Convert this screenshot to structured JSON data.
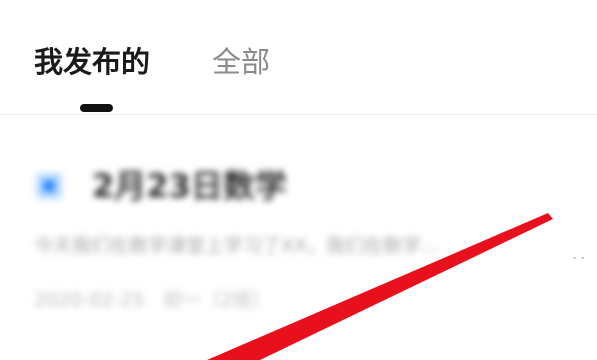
{
  "tabs": {
    "mine_label": "我发布的",
    "all_label": "全部"
  },
  "post": {
    "title": "2月23日数学",
    "description": "今天我们在数学课堂上学习了XX，我们在数学...",
    "more": "..",
    "meta": "2020-02-25　初一（2班）"
  },
  "colors": {
    "active_tab": "#1a1a1a",
    "inactive_tab": "#8a8a8a",
    "tag": "#2f8cff",
    "annotation_arrow": "#e8101c"
  },
  "icons": {
    "tag": "square-tag-icon",
    "arrow": "red-arrow-annotation"
  }
}
